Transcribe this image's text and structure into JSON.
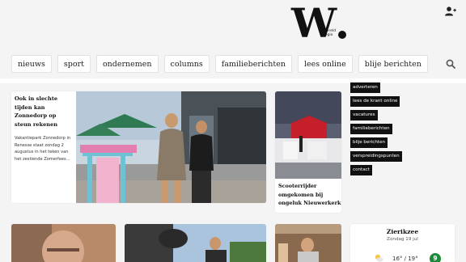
{
  "logo": {
    "letter": "W",
    "subtitle_line1": "wereld",
    "subtitle_line2": "regio"
  },
  "nav": {
    "items": [
      "nieuws",
      "sport",
      "ondernemen",
      "columns",
      "familieberichten",
      "lees online",
      "blije berichten"
    ]
  },
  "icons": {
    "search": "search-icon",
    "account": "user-add-icon"
  },
  "feature": {
    "title": "Ook in slechte tijden kan Zonnedorp op steun rekenen",
    "excerpt": "Vakantiepark Zonnedorp in Renesse staat zondag 2 augustus in het teken van het zestiende Zomerfees..."
  },
  "second_article": {
    "title": "Scooterrijder omgekomen bij ongeluk Nieuwerkerk"
  },
  "sidebar": {
    "items": [
      "adverteren",
      "lees de krant online",
      "vacatures",
      "familieberichten",
      "blije berichten",
      "verspreidingspunten",
      "contact"
    ]
  },
  "weather": {
    "city": "Zierikzee",
    "date": "Zondag 19 jul",
    "temp": "16° / 19°",
    "badge": "9",
    "badge_color": "#1d8a3b"
  }
}
